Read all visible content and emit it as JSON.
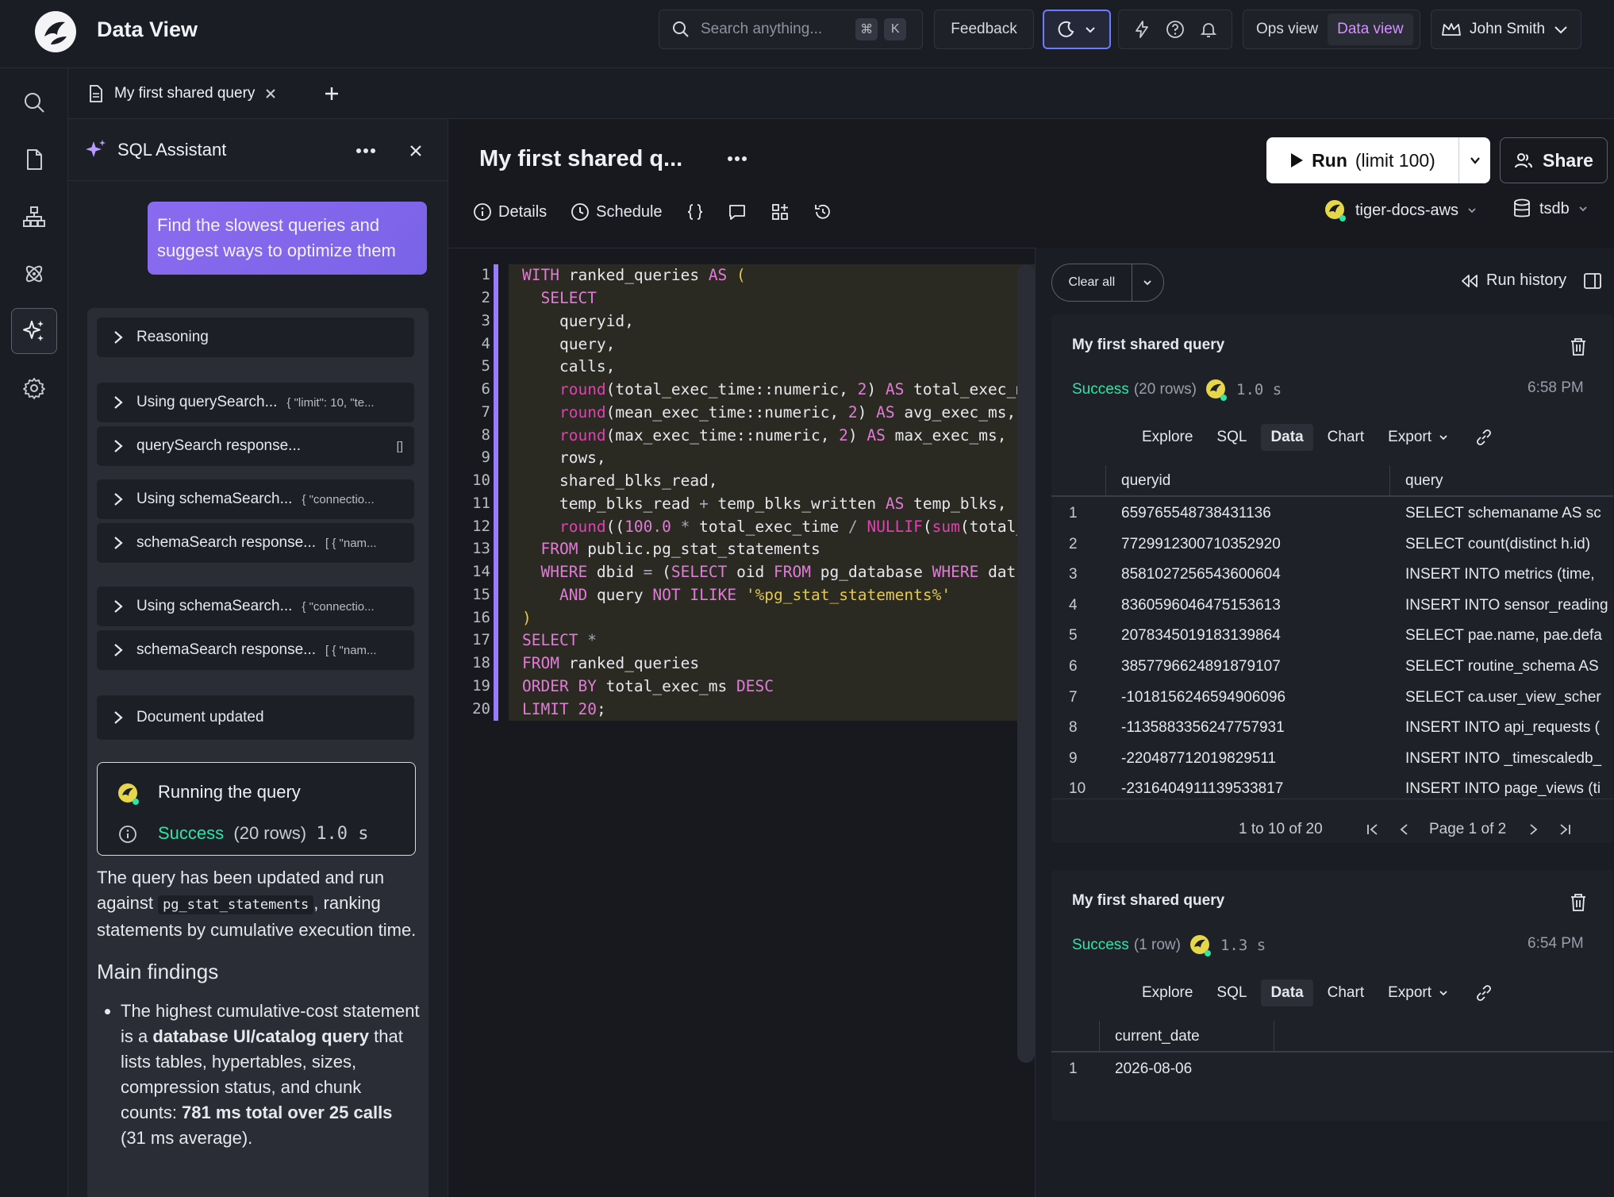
{
  "app": {
    "title": "Data View"
  },
  "topbar": {
    "search_placeholder": "Search anything...",
    "shortcut_mod": "⌘",
    "shortcut_key": "K",
    "feedback_label": "Feedback",
    "views": [
      "Ops view",
      "Data view"
    ],
    "active_view": "Data view",
    "user_name": "John Smith"
  },
  "tabs": [
    {
      "label": "My first shared query"
    }
  ],
  "assistant": {
    "title": "SQL Assistant",
    "user_message": "Find the slowest queries and suggest ways to optimize them",
    "trace": [
      {
        "label": "Reasoning",
        "arg": ""
      },
      {
        "label": "Using querySearch...",
        "arg": "{ \"limit\": 10, \"te..."
      },
      {
        "label": "querySearch response...",
        "arg": "[]"
      },
      {
        "label": "Using schemaSearch...",
        "arg": "{ \"connectio..."
      },
      {
        "label": "schemaSearch response...",
        "arg": "[ { \"nam..."
      },
      {
        "label": "Using schemaSearch...",
        "arg": "{ \"connectio..."
      },
      {
        "label": "schemaSearch response...",
        "arg": "[ { \"nam..."
      },
      {
        "label": "Document updated",
        "arg": ""
      }
    ],
    "run_card": {
      "title": "Running the query",
      "status": "Success",
      "rows": "(20 rows)",
      "duration": "1.0 s"
    },
    "answer_pre": "The query has been updated and run against ",
    "answer_code": "pg_stat_statements",
    "answer_post": ", ranking statements by cumulative execution time.",
    "findings_heading": "Main findings",
    "finding_1_a": "The highest cumulative-cost statement is a ",
    "finding_1_b": "database UI/catalog query",
    "finding_1_c": " that lists tables, hypertables, sizes, compression status, and chunk counts: ",
    "finding_1_d": "781 ms total over 25 calls",
    "finding_1_e": " (31 ms average)."
  },
  "editor": {
    "doc_title": "My first shared q...",
    "run_label": "Run",
    "run_limit": "(limit 100)",
    "share_label": "Share",
    "toolbar": {
      "details": "Details",
      "schedule": "Schedule"
    },
    "connection": "tiger-docs-aws",
    "database": "tsdb",
    "line_numbers": [
      "1",
      "2",
      "3",
      "4",
      "5",
      "6",
      "7",
      "8",
      "9",
      "10",
      "11",
      "12",
      "13",
      "14",
      "15",
      "16",
      "17",
      "18",
      "19",
      "20"
    ]
  },
  "results": {
    "clear_all": "Clear all",
    "run_history": "Run history",
    "tabs": [
      "Explore",
      "SQL",
      "Data",
      "Chart",
      "Export"
    ],
    "active_tab": "Data",
    "cards": [
      {
        "title": "My first shared query",
        "status": "Success",
        "rows": "(20 rows)",
        "duration": "1.0 s",
        "time": "6:58 PM",
        "columns": [
          "queryid",
          "query"
        ],
        "data": [
          [
            "1",
            "659765548738431136",
            "SELECT schemaname AS sc"
          ],
          [
            "2",
            "7729912300710352920",
            "SELECT count(distinct h.id)"
          ],
          [
            "3",
            "8581027256543600604",
            "INSERT INTO metrics (time,"
          ],
          [
            "4",
            "8360596046475153613",
            "INSERT INTO sensor_reading"
          ],
          [
            "5",
            "2078345019183139864",
            "SELECT pae.name, pae.defa"
          ],
          [
            "6",
            "3857796624891879107",
            "SELECT routine_schema AS"
          ],
          [
            "7",
            "-1018156246594906096",
            "SELECT ca.user_view_scher"
          ],
          [
            "8",
            "-1135883356247757931",
            "INSERT INTO api_requests ("
          ],
          [
            "9",
            "-220487712019829511",
            "INSERT INTO _timescaledb_"
          ],
          [
            "10",
            "-2316404911139533817",
            "INSERT INTO page_views (ti"
          ]
        ],
        "range": "1 to 10 of 20",
        "page": "Page 1 of 2"
      },
      {
        "title": "My first shared query",
        "status": "Success",
        "rows": "(1 row)",
        "duration": "1.3 s",
        "time": "6:54 PM",
        "columns": [
          "current_date"
        ],
        "data": [
          [
            "1",
            "2026-08-06"
          ]
        ]
      }
    ]
  },
  "colors": {
    "accent": "#9a7bff",
    "success": "#2ee5a5",
    "user_bubble": "#8a6bef"
  }
}
